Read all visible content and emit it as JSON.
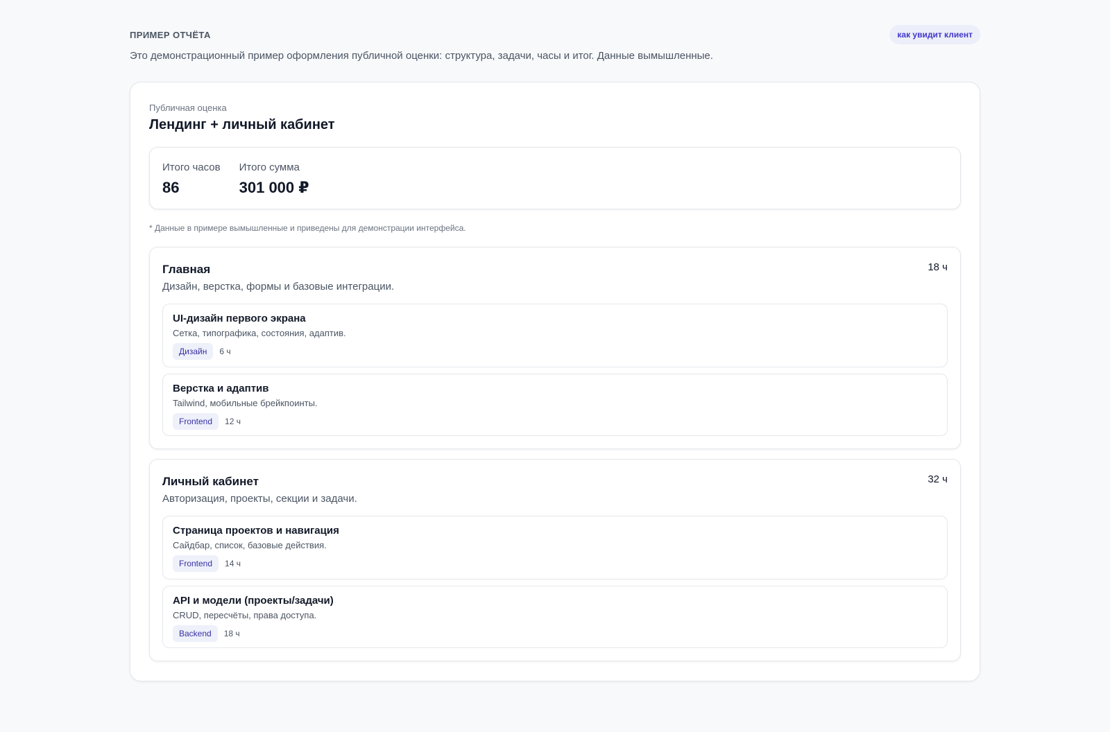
{
  "header": {
    "eyebrow": "ПРИМЕР ОТЧЁТА",
    "view_badge": "как увидит клиент",
    "intro": "Это демонстрационный пример оформления публичной оценки: структура, задачи, часы и итог. Данные вымышленные."
  },
  "estimate": {
    "kicker": "Публичная оценка",
    "title": "Лендинг + личный кабинет",
    "totals": {
      "hours_label": "Итого часов",
      "hours_value": "86",
      "sum_label": "Итого сумма",
      "sum_value": "301 000 ₽"
    },
    "footnote": "* Данные в примере вымышленные и приведены для демонстрации интерфейса.",
    "sections": [
      {
        "title": "Главная",
        "hours": "18 ч",
        "desc": "Дизайн, верстка, формы и базовые интеграции.",
        "tasks": [
          {
            "title": "UI-дизайн первого экрана",
            "desc": "Сетка, типографика, состояния, адаптив.",
            "tag": "Дизайн",
            "hours": "6 ч"
          },
          {
            "title": "Верстка и адаптив",
            "desc": "Tailwind, мобильные брейкпоинты.",
            "tag": "Frontend",
            "hours": "12 ч"
          }
        ]
      },
      {
        "title": "Личный кабинет",
        "hours": "32 ч",
        "desc": "Авторизация, проекты, секции и задачи.",
        "tasks": [
          {
            "title": "Страница проектов и навигация",
            "desc": "Сайдбар, список, базовые действия.",
            "tag": "Frontend",
            "hours": "14 ч"
          },
          {
            "title": "API и модели (проекты/задачи)",
            "desc": "CRUD, пересчёты, права доступа.",
            "tag": "Backend",
            "hours": "18 ч"
          }
        ]
      }
    ]
  },
  "colors": {
    "background": "#f8f9fb",
    "accent": "#4338ca",
    "tag_bg": "#eef0fa"
  }
}
